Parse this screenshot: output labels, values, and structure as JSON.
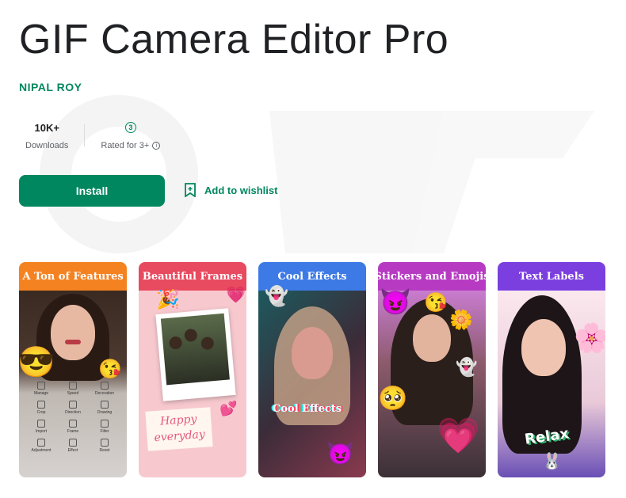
{
  "app": {
    "title": "GIF Camera Editor Pro",
    "developer": "NIPAL ROY"
  },
  "stats": {
    "downloads_value": "10K+",
    "downloads_label": "Downloads",
    "rating_badge": "3",
    "rating_label": "Rated for 3+"
  },
  "actions": {
    "install_label": "Install",
    "wishlist_label": "Add to wishlist"
  },
  "screenshots": [
    {
      "header": "A Ton of Features",
      "color": "#f58220"
    },
    {
      "header": "Beautiful Frames",
      "color": "#e84a5f",
      "note": "Happy everyday"
    },
    {
      "header": "Cool Effects",
      "color": "#3d7ae6",
      "overlay": "Cool Effects"
    },
    {
      "header": "Stickers and Emojis",
      "color": "#b63bc2"
    },
    {
      "header": "Text Labels",
      "color": "#7b3fe0",
      "overlay": "Relax"
    }
  ],
  "feature_menu": [
    "Manage",
    "Speed",
    "Decoration",
    "Crop",
    "Direction",
    "Drawing",
    "Import",
    "Frame",
    "Filter",
    "Adjustment",
    "Effect",
    "Reset"
  ],
  "icons": {
    "rating": "rated-3-plus-icon",
    "info": "info-icon",
    "wishlist": "bookmark-add-icon"
  }
}
